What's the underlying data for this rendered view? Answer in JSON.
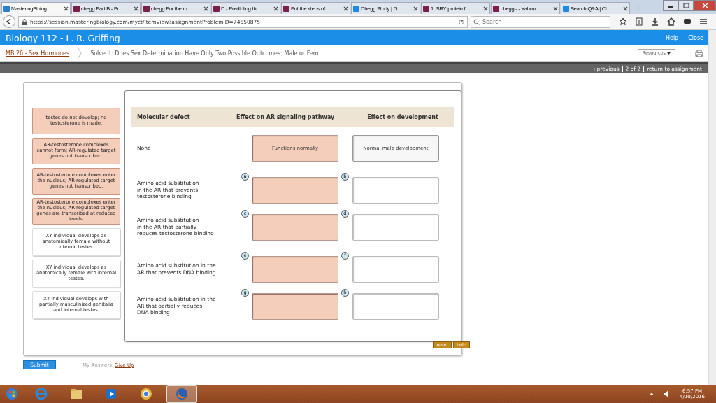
{
  "browser": {
    "tabs": [
      {
        "title": "MasteringBiolog...",
        "selected": true
      },
      {
        "title": "chegg Part B - Pr...",
        "selected": false
      },
      {
        "title": "chegg For the m...",
        "selected": false
      },
      {
        "title": "D - Predicting th...",
        "selected": false
      },
      {
        "title": "Put the steps of ...",
        "selected": false
      },
      {
        "title": "Chegg Study | G...",
        "selected": false
      },
      {
        "title": "1. SRY protein fr...",
        "selected": false
      },
      {
        "title": "chegg - - Yahoo ...",
        "selected": false
      },
      {
        "title": "Search Q&A | Ch...",
        "selected": false
      }
    ],
    "new_tab": "+",
    "url": "https://session.masteringbiology.com/myct/itemView?assignmentProblemID=74550875",
    "search": {
      "placeholder": "Search"
    }
  },
  "header": {
    "title": "Biology 112 - L. R. Griffing",
    "links": [
      "Help",
      "Close"
    ]
  },
  "breadcrumb": {
    "course": "MB 26 - Sex Hormones",
    "item": "Solve It: Does Sex Determination Have Only Two Possible Outcomes: Male or Fem",
    "resources": "Resources"
  },
  "pager": {
    "previous": "‹ previous",
    "position": "2 of 2",
    "return": "return to assignment"
  },
  "answer_bank": [
    {
      "text": "testes do not develop; no testosterone is made.",
      "kind": "pathway"
    },
    {
      "text": "AR-testosterone complexes cannot form; AR-regulated target genes not transcribed.",
      "kind": "pathway"
    },
    {
      "text": "AR-testosterone complexes enter the nucleus; AR-regulated target genes not transcribed.",
      "kind": "pathway"
    },
    {
      "text": "AR-testosterone complexes enter the nucleus; AR-regulated target genes are transcribed at reduced levels.",
      "kind": "pathway"
    },
    {
      "text": "XY individual develops as anatomically female without internal testes.",
      "kind": "development"
    },
    {
      "text": "XY individual develops as anatomically female with internal testes.",
      "kind": "development"
    },
    {
      "text": "XY individual develops with partially masculinized genitalia and internal testes.",
      "kind": "development"
    }
  ],
  "table": {
    "columns": [
      "Molecular defect",
      "Effect on AR signaling pathway",
      "Effect on development"
    ],
    "groups": [
      {
        "rows": [
          {
            "defect": "None",
            "pathway": {
              "text": "Functions normally"
            },
            "development": {
              "text": "Normal male development"
            }
          }
        ]
      },
      {
        "rows": [
          {
            "defect": "Amino acid substitution\nin the AR that prevents\ntestosterone binding",
            "pathway": {
              "label": "a"
            },
            "development": {
              "label": "b"
            }
          },
          {
            "defect": "Amino acid substitution\nin the AR that partially\nreduces testosterone binding",
            "pathway": {
              "label": "c"
            },
            "development": {
              "label": "d"
            }
          }
        ]
      },
      {
        "rows": [
          {
            "defect": "Amino acid substitution in the\nAR that prevents DNA binding",
            "pathway": {
              "label": "e"
            },
            "development": {
              "label": "f"
            }
          },
          {
            "defect": "Amino acid substitution in the\nAR that partially reduces\nDNA binding",
            "pathway": {
              "label": "g"
            },
            "development": {
              "label": "h"
            }
          }
        ]
      }
    ]
  },
  "tools": [
    "reset",
    "help"
  ],
  "submit": "Submit",
  "my_answers": "My Answers",
  "give_up": "Give Up",
  "taskbar": {
    "time": "6:57 PM",
    "date": "4/10/2016"
  }
}
